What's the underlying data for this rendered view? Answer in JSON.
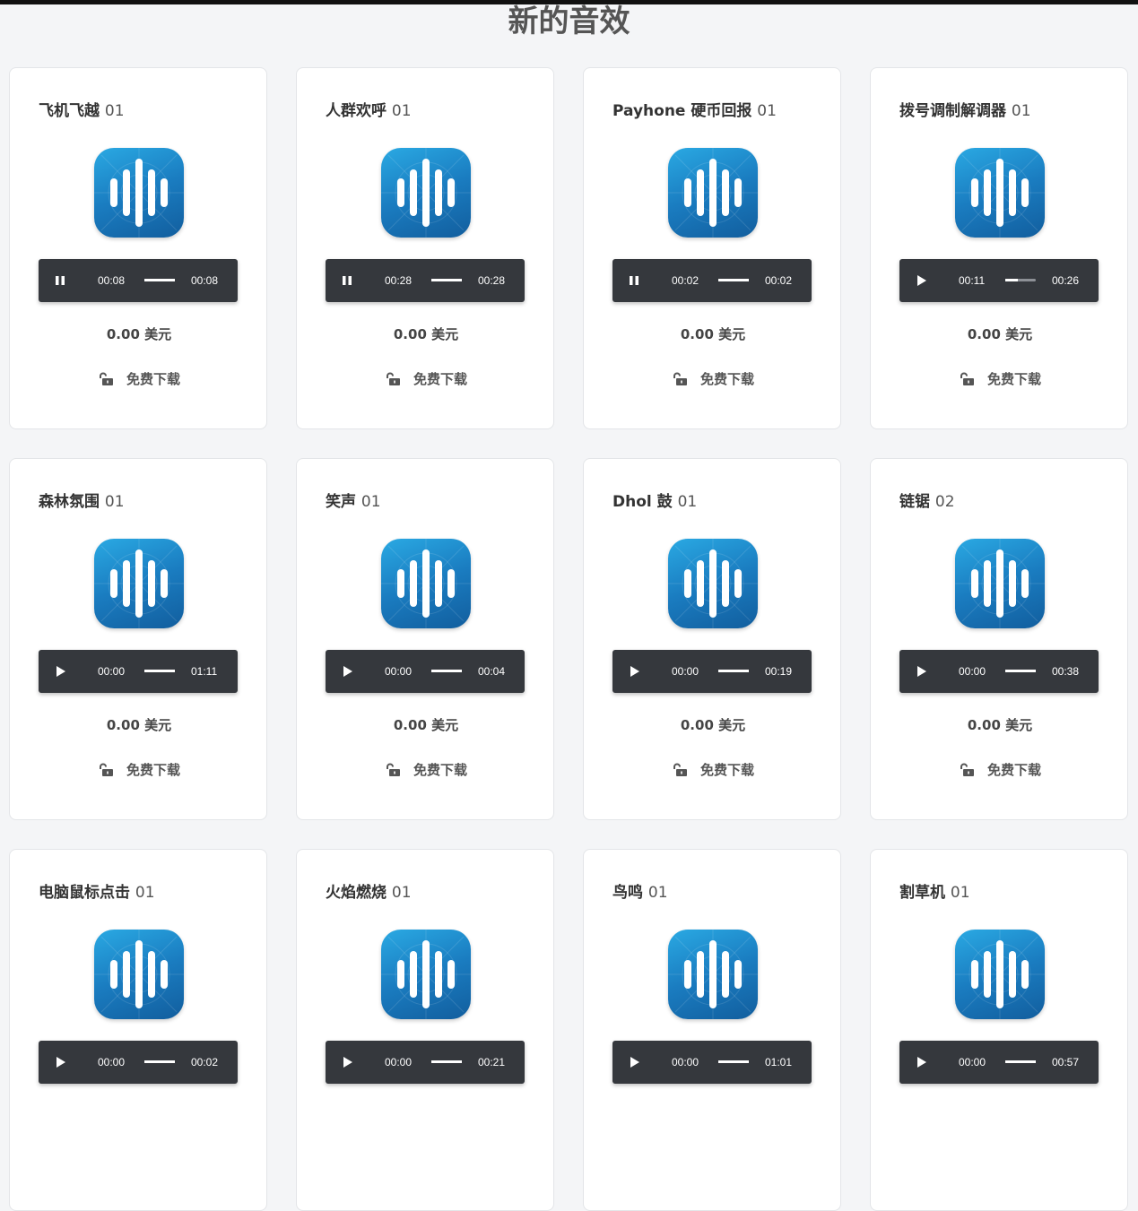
{
  "page": {
    "title": "新的音效"
  },
  "cards": [
    {
      "name": "飞机飞越",
      "num": "01",
      "state": "pause",
      "current": "00:08",
      "total": "00:08",
      "progress": 1.0,
      "price": "0.00 美元",
      "download": "免费下载"
    },
    {
      "name": "人群欢呼",
      "num": "01",
      "state": "pause",
      "current": "00:28",
      "total": "00:28",
      "progress": 1.0,
      "price": "0.00 美元",
      "download": "免费下载"
    },
    {
      "name": "Payhone 硬币回报",
      "num": "01",
      "state": "pause",
      "current": "00:02",
      "total": "00:02",
      "progress": 1.0,
      "price": "0.00 美元",
      "download": "免费下载"
    },
    {
      "name": "拨号调制解调器",
      "num": "01",
      "state": "play",
      "current": "00:11",
      "total": "00:26",
      "progress": 0.42,
      "price": "0.00 美元",
      "download": "免费下载"
    },
    {
      "name": "森林氛围",
      "num": "01",
      "state": "play",
      "current": "00:00",
      "total": "01:11",
      "progress": 1.0,
      "price": "0.00 美元",
      "download": "免费下载"
    },
    {
      "name": "笑声",
      "num": "01",
      "state": "play",
      "current": "00:00",
      "total": "00:04",
      "progress": 1.0,
      "price": "0.00 美元",
      "download": "免费下载"
    },
    {
      "name": "Dhol 鼓",
      "num": "01",
      "state": "play",
      "current": "00:00",
      "total": "00:19",
      "progress": 1.0,
      "price": "0.00 美元",
      "download": "免费下载"
    },
    {
      "name": "链锯",
      "num": "02",
      "state": "play",
      "current": "00:00",
      "total": "00:38",
      "progress": 1.0,
      "price": "0.00 美元",
      "download": "免费下载"
    },
    {
      "name": "电脑鼠标点击",
      "num": "01",
      "state": "play",
      "current": "00:00",
      "total": "00:02",
      "progress": 1.0,
      "price": "",
      "download": ""
    },
    {
      "name": "火焰燃烧",
      "num": "01",
      "state": "play",
      "current": "00:00",
      "total": "00:21",
      "progress": 1.0,
      "price": "",
      "download": ""
    },
    {
      "name": "鸟鸣",
      "num": "01",
      "state": "play",
      "current": "00:00",
      "total": "01:01",
      "progress": 1.0,
      "price": "",
      "download": ""
    },
    {
      "name": "割草机",
      "num": "01",
      "state": "play",
      "current": "00:00",
      "total": "00:57",
      "progress": 1.0,
      "price": "",
      "download": ""
    }
  ],
  "icons": {
    "app": "sound-wave-icon",
    "play": "play-icon",
    "pause": "pause-icon",
    "download": "unlock-icon"
  },
  "colors": {
    "player_bg": "#35383d",
    "icon_top": "#2aa9e3",
    "icon_bottom": "#125e9e"
  }
}
